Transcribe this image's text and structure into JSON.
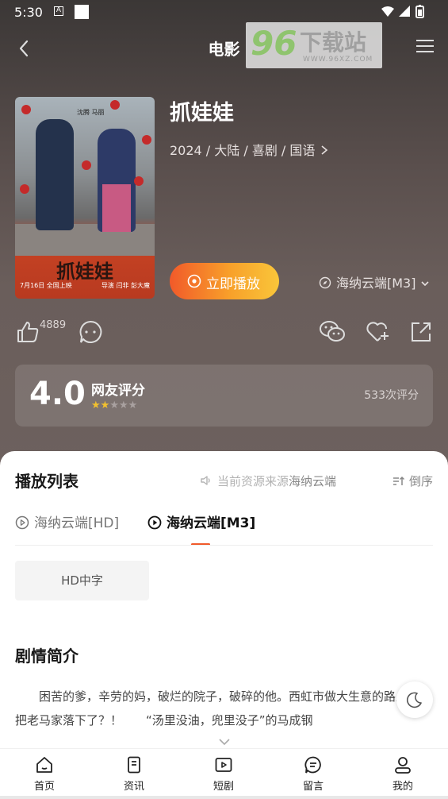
{
  "status_bar": {
    "time": "5:30",
    "notif_a": "A"
  },
  "header": {
    "title": "电影"
  },
  "watermark": {
    "logo": "96",
    "text": "下载站",
    "url": "WWW.96XZ.COM"
  },
  "movie": {
    "title": "抓娃娃",
    "meta": "2024 / 大陆 / 喜剧 / 国语",
    "poster": {
      "title": "抓娃娃",
      "cast": "沈腾 马丽",
      "release": "7月16日 全国上映",
      "director": "导演 闫非 彭大魔"
    }
  },
  "play_button": {
    "label": "立即播放"
  },
  "source_selector": {
    "label": "海纳云端[M3]"
  },
  "actions": {
    "like_count": "4889"
  },
  "rating": {
    "score": "4.0",
    "label": "网友评分",
    "stars_on": 2,
    "stars_total": 5,
    "count": "533次评分"
  },
  "playlist": {
    "title": "播放列表",
    "source_note_prefix": "当前资源来源",
    "source_note_value": "海纳云端",
    "sort_label": "倒序",
    "tabs": [
      {
        "label": "海纳云端[HD]",
        "active": false
      },
      {
        "label": "海纳云端[M3]",
        "active": true
      }
    ],
    "episodes": [
      "HD中字"
    ]
  },
  "synopsis": {
    "title": "剧情简介",
    "text": "困苦的爹，辛劳的妈，破烂的院子，破碎的他。西虹市做大生意的路上怎么把老马家落下了？！　　“汤里没油，兜里没子”的马成钢"
  },
  "bottom_nav": {
    "items": [
      {
        "label": "首页",
        "icon": "home-icon"
      },
      {
        "label": "资讯",
        "icon": "news-icon"
      },
      {
        "label": "短剧",
        "icon": "short-drama-icon"
      },
      {
        "label": "留言",
        "icon": "message-icon"
      },
      {
        "label": "我的",
        "icon": "profile-icon"
      }
    ]
  },
  "colors": {
    "accent": "#f05a2b",
    "play_gradient_start": "#f15a2a",
    "play_gradient_end": "#f9c63a",
    "star": "#f2c12e"
  }
}
